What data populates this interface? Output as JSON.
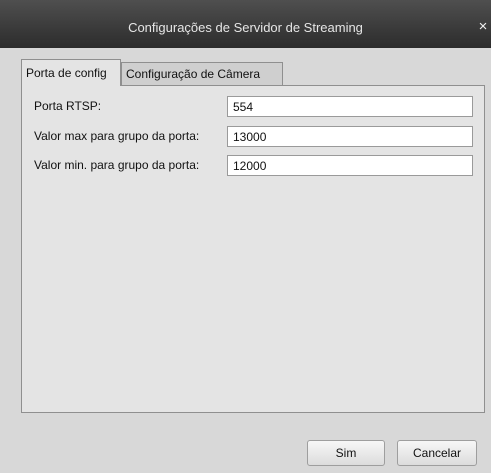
{
  "window": {
    "title": "Configurações de Servidor de Streaming",
    "close_icon": "×"
  },
  "tabs": [
    {
      "label": "Porta de config",
      "active": true
    },
    {
      "label": "Configuração de Câmera",
      "active": false
    }
  ],
  "form": {
    "rows": [
      {
        "label": "Porta RTSP:",
        "value": "554"
      },
      {
        "label": "Valor max para grupo da porta:",
        "value": "13000"
      },
      {
        "label": "Valor min. para grupo da porta:",
        "value": "12000"
      }
    ]
  },
  "buttons": {
    "ok_label": "Sim",
    "cancel_label": "Cancelar"
  },
  "colors": {
    "titlebar": "#3a3a3a",
    "panel": "#e4e4e4",
    "window_bg": "#d8d8d8"
  }
}
